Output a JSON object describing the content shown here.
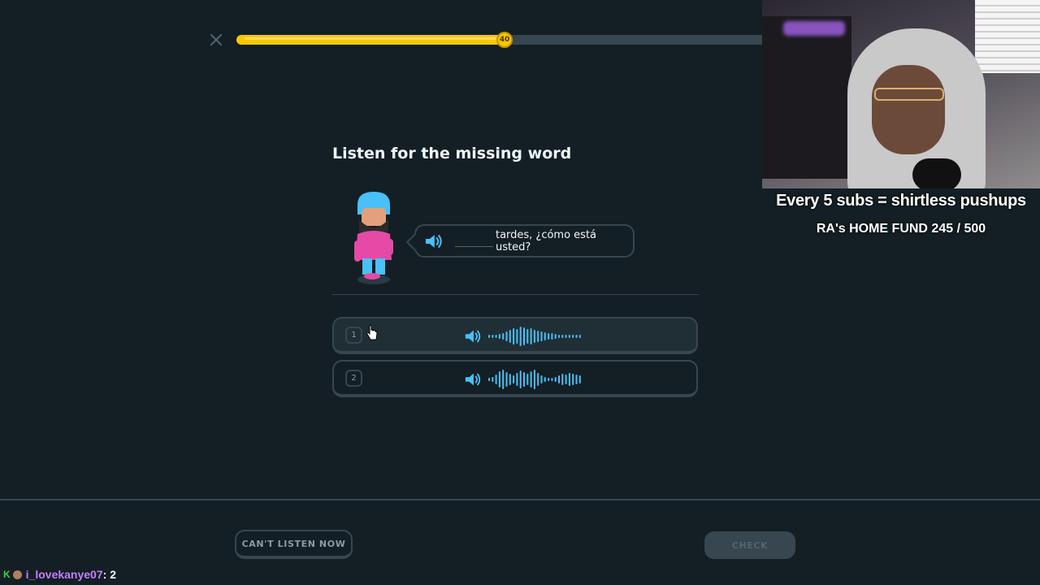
{
  "progress": {
    "value_fraction": 0.5,
    "streak_count": "40"
  },
  "stream_overlay": {
    "subs_text": "Every 5 subs = shirtless pushups",
    "fund_text": "RA's HOME FUND 245 / 500"
  },
  "exercise": {
    "title": "Listen for the missing word",
    "sentence_rest": "tardes, ¿cómo está usted?",
    "options": [
      {
        "number": "1"
      },
      {
        "number": "2"
      }
    ]
  },
  "footer": {
    "cant_listen_label": "CAN'T LISTEN NOW",
    "check_label": "CHECK"
  },
  "chat": {
    "username": "i_lovekanye07",
    "message": ": 2"
  },
  "colors": {
    "background": "#131f24",
    "accent_audio": "#49c0f8",
    "progress": "#f7c800",
    "chat_user": "#c77dff"
  }
}
